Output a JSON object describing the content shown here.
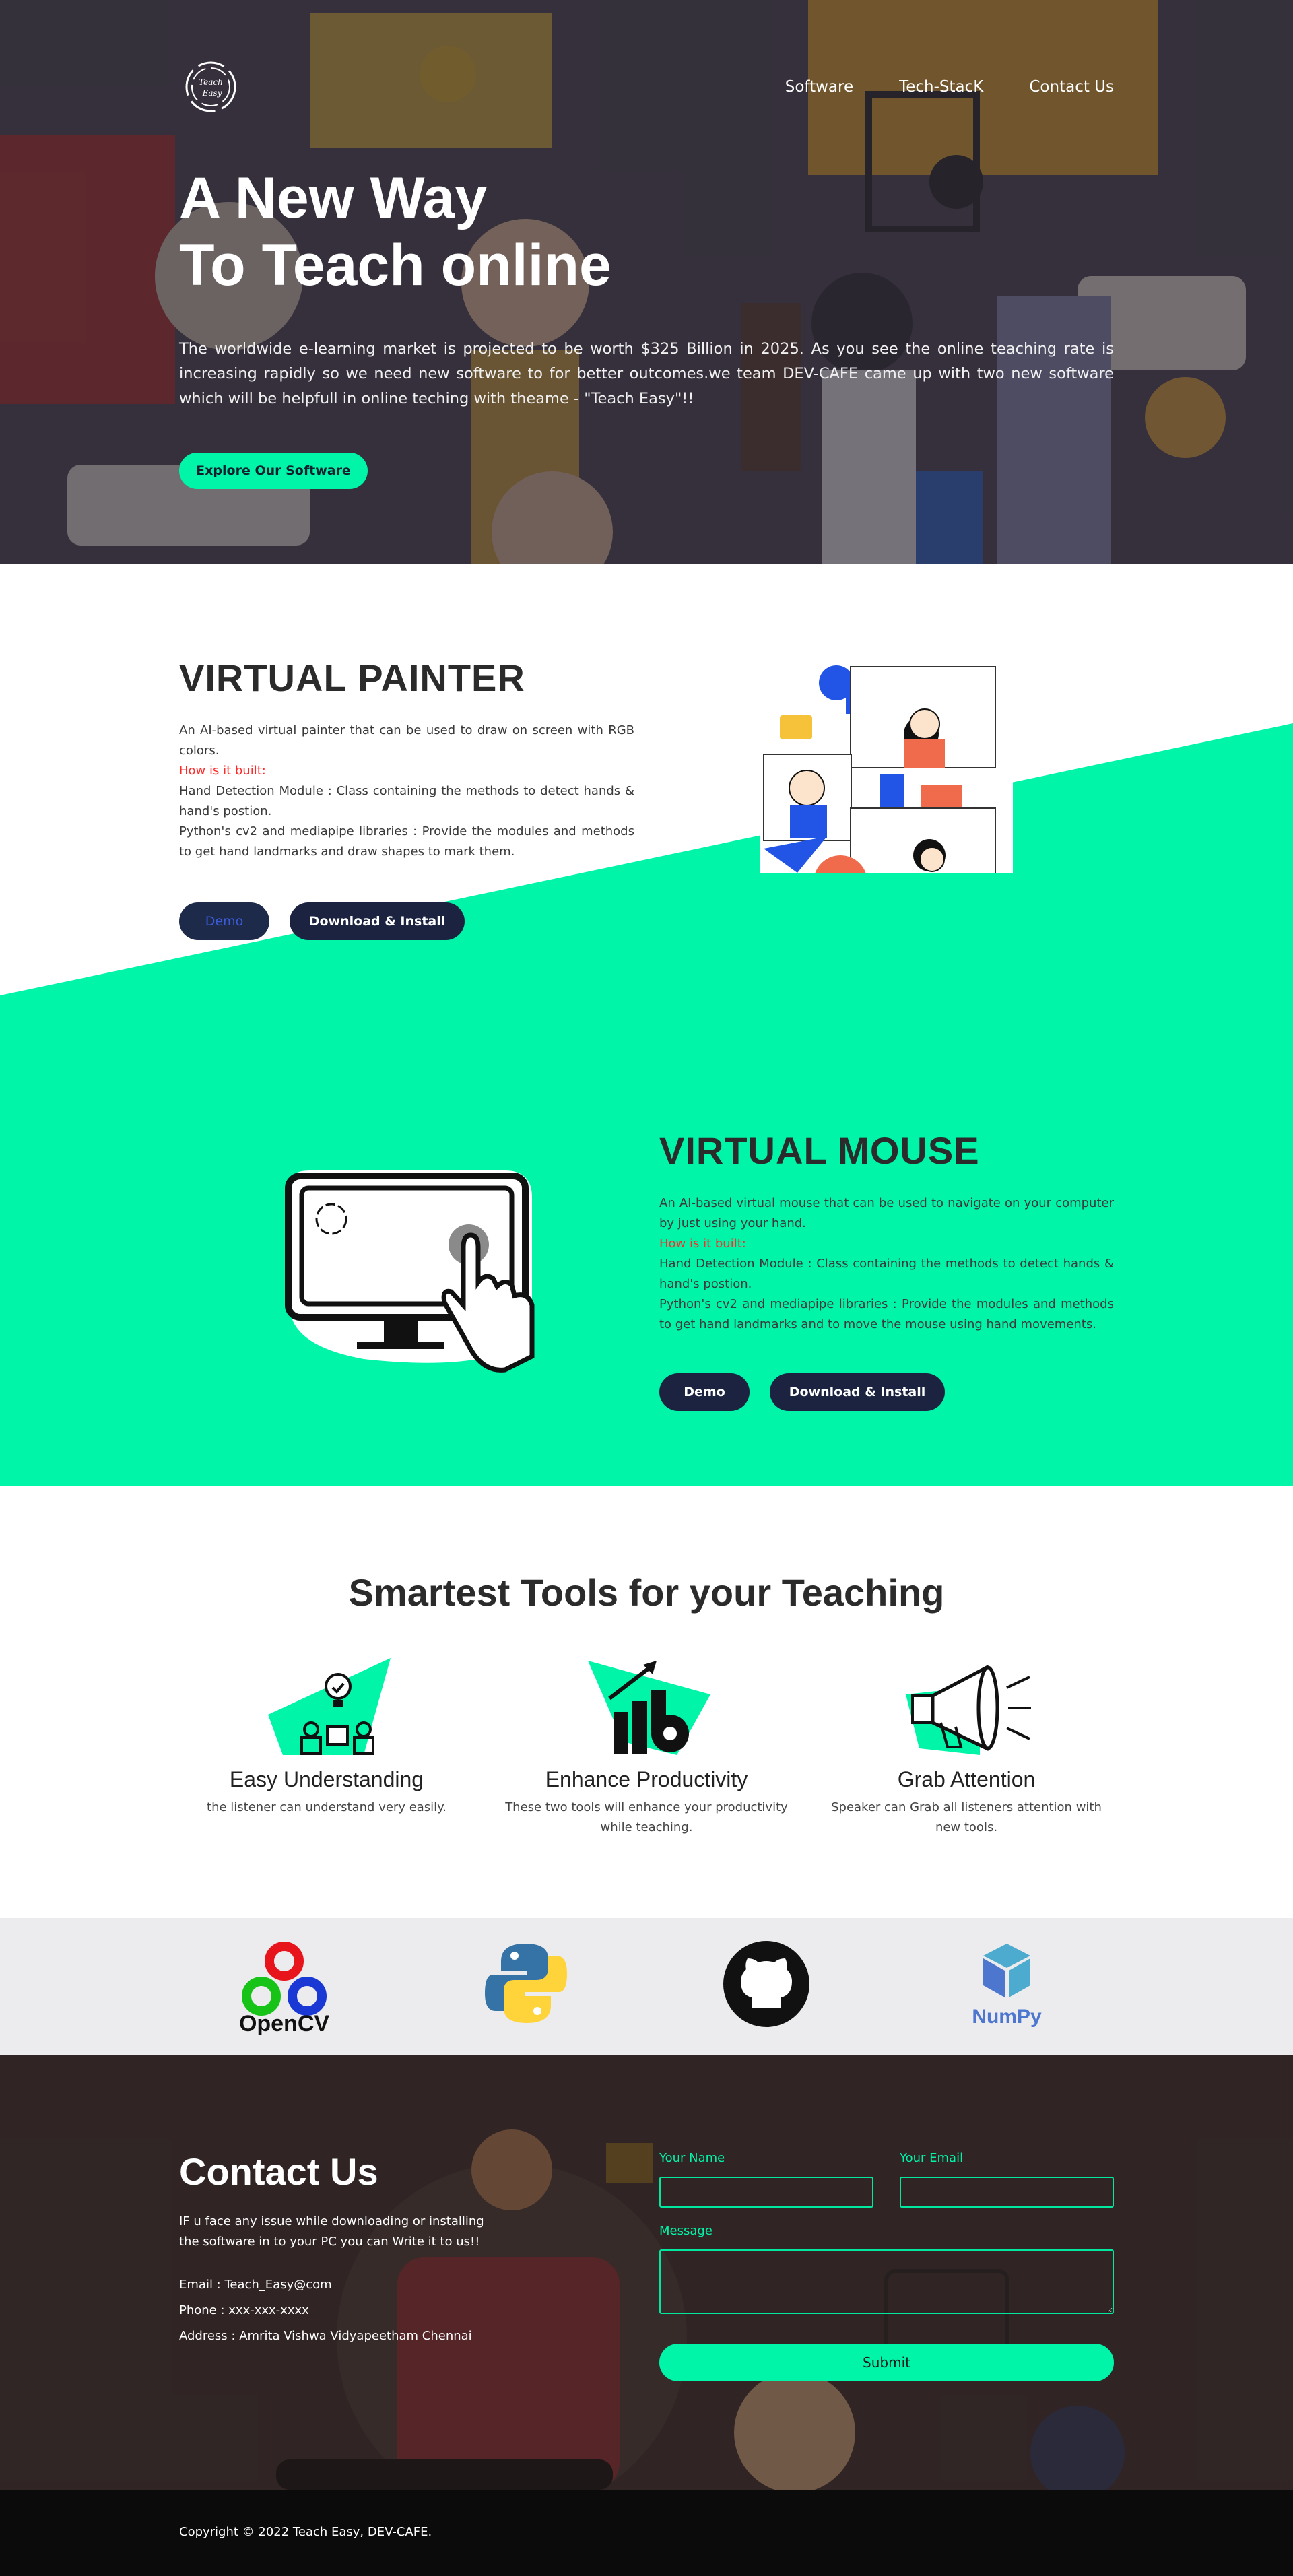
{
  "nav": {
    "items": [
      "Software",
      "Tech-StacK",
      "Contact Us"
    ]
  },
  "logo": {
    "text_top": "Teach",
    "text_bottom": "Easy"
  },
  "hero": {
    "title_line1": "A New Way",
    "title_line2": "To Teach online",
    "description": "The worldwide e-learning market is projected to be worth $325 Billion in 2025. As you see the online teaching rate is increasing rapidly so we need new software to for better outcomes.we team DEV-CAFE came up with two new software which will be helpfull in online teching with theame - \"Teach Easy\"!!",
    "cta": "Explore Our Software"
  },
  "painter": {
    "title": "VIRTUAL PAINTER",
    "desc": "An AI-based virtual painter that can be used to draw on screen with RGB colors.",
    "how": "How is it built:",
    "line1": "Hand Detection Module : Class containing the methods to detect hands & hand's postion.",
    "line2": "Python's cv2 and mediapipe libraries : Provide the modules and methods to get hand landmarks and draw shapes to mark them.",
    "demo": "Demo",
    "download": "Download & Install"
  },
  "mouse": {
    "title": "VIRTUAL MOUSE",
    "desc": "An AI-based virtual mouse that can be used to navigate on your computer by just using your hand.",
    "how": "How is it built:",
    "line1": "Hand Detection Module : Class containing the methods to detect hands & hand's postion.",
    "line2": "Python's cv2 and mediapipe libraries : Provide the modules and methods to get hand landmarks and to move the mouse using hand movements.",
    "demo": "Demo",
    "download": "Download & Install"
  },
  "tools": {
    "heading": "Smartest Tools for your Teaching",
    "items": [
      {
        "title": "Easy Understanding",
        "text": "the listener can understand very easily."
      },
      {
        "title": "Enhance Productivity",
        "text": "These two tools will enhance your productivity while teaching."
      },
      {
        "title": "Grab Attention",
        "text": "Speaker can Grab all listeners attention with new tools."
      }
    ]
  },
  "stack": {
    "opencv": "OpenCV",
    "numpy": "NumPy"
  },
  "contact": {
    "title": "Contact Us",
    "intro": "IF u face any issue while downloading or installing the software in to your PC you can Write it to us!!",
    "email": "Email : Teach_Easy@com",
    "phone": "Phone : xxx-xxx-xxxx",
    "address": "Address : Amrita Vishwa Vidyapeetham Chennai",
    "name_label": "Your Name",
    "email_label": "Your Email",
    "message_label": "Message",
    "submit": "Submit"
  },
  "footer": {
    "copyright": "Copyright © 2022 Teach Easy, DEV-CAFE."
  },
  "colors": {
    "accent": "#00f5a8",
    "navy": "#1b2340",
    "hero_bg": "#3d3a42",
    "contact_bg": "#3a2f2d"
  }
}
